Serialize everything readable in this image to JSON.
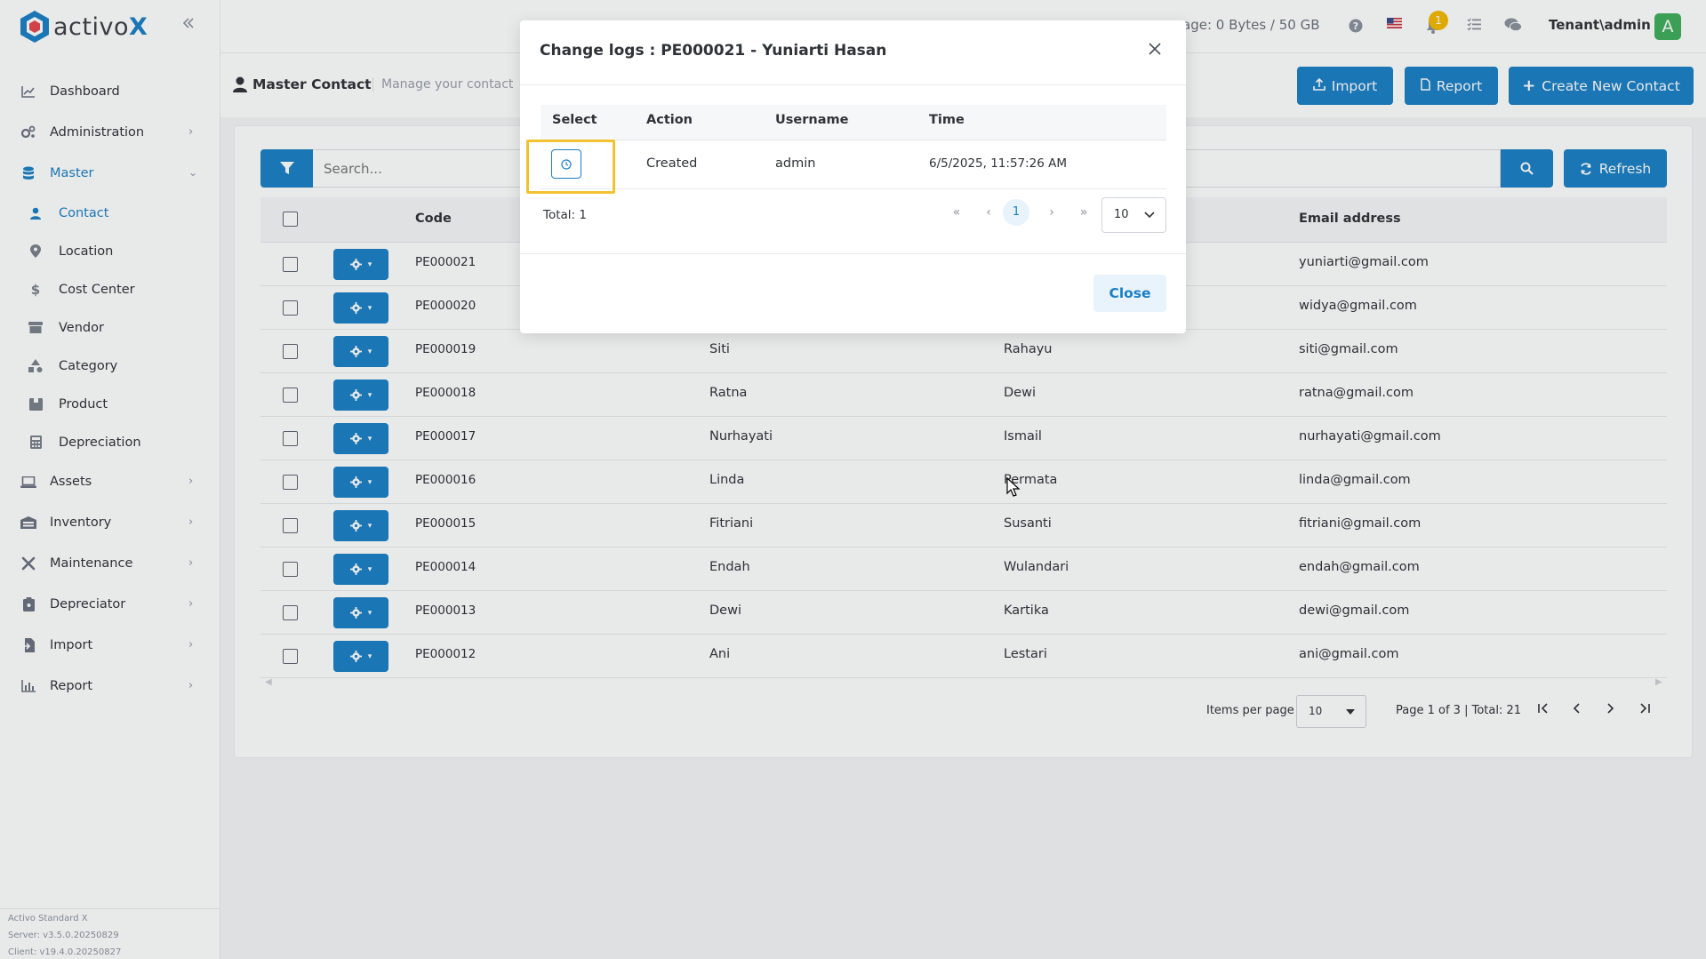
{
  "brand": {
    "name_plain": "activo",
    "name_accent": "X"
  },
  "sidebar": {
    "items": [
      {
        "label": "Dashboard",
        "icon": "chart-line-icon",
        "has_children": false
      },
      {
        "label": "Administration",
        "icon": "gears-icon",
        "has_children": true
      },
      {
        "label": "Master",
        "icon": "database-icon",
        "has_children": true,
        "expanded": true
      }
    ],
    "master_children": [
      {
        "label": "Contact",
        "icon": "user-icon",
        "active": true
      },
      {
        "label": "Location",
        "icon": "map-pin-icon"
      },
      {
        "label": "Cost Center",
        "icon": "dollar-icon"
      },
      {
        "label": "Vendor",
        "icon": "store-icon"
      },
      {
        "label": "Category",
        "icon": "shapes-icon"
      },
      {
        "label": "Product",
        "icon": "box-icon"
      },
      {
        "label": "Depreciation",
        "icon": "calculator-icon"
      }
    ],
    "items_after": [
      {
        "label": "Assets",
        "icon": "laptop-icon"
      },
      {
        "label": "Inventory",
        "icon": "warehouse-icon"
      },
      {
        "label": "Maintenance",
        "icon": "tools-icon"
      },
      {
        "label": "Depreciator",
        "icon": "clipboard-icon"
      },
      {
        "label": "Import",
        "icon": "file-import-icon"
      },
      {
        "label": "Report",
        "icon": "chart-bar-icon"
      }
    ],
    "footer": {
      "product": "Activo Standard X",
      "server": "Server: v3.5.0.20250829",
      "client": "Client: v19.4.0.20250827"
    }
  },
  "topbar": {
    "storage": "age: 0 Bytes / 50 GB",
    "notification_count": "1",
    "user": "Tenant\\admin",
    "avatar_letter": "A"
  },
  "page": {
    "title": "Master Contact",
    "subtitle": "Manage your contact",
    "buttons": {
      "import": "Import",
      "report": "Report",
      "create": "Create New Contact"
    }
  },
  "toolbar": {
    "search_placeholder": "Search...",
    "refresh": "Refresh"
  },
  "table": {
    "headers": {
      "code": "Code",
      "email": "Email address"
    },
    "rows": [
      {
        "code": "PE000021",
        "first": "",
        "last": "",
        "email": "yuniarti@gmail.com"
      },
      {
        "code": "PE000020",
        "first": "",
        "last": "",
        "email": "widya@gmail.com"
      },
      {
        "code": "PE000019",
        "first": "Siti",
        "last": "Rahayu",
        "email": "siti@gmail.com"
      },
      {
        "code": "PE000018",
        "first": "Ratna",
        "last": "Dewi",
        "email": "ratna@gmail.com"
      },
      {
        "code": "PE000017",
        "first": "Nurhayati",
        "last": "Ismail",
        "email": "nurhayati@gmail.com"
      },
      {
        "code": "PE000016",
        "first": "Linda",
        "last": "Permata",
        "email": "linda@gmail.com"
      },
      {
        "code": "PE000015",
        "first": "Fitriani",
        "last": "Susanti",
        "email": "fitriani@gmail.com"
      },
      {
        "code": "PE000014",
        "first": "Endah",
        "last": "Wulandari",
        "email": "endah@gmail.com"
      },
      {
        "code": "PE000013",
        "first": "Dewi",
        "last": "Kartika",
        "email": "dewi@gmail.com"
      },
      {
        "code": "PE000012",
        "first": "Ani",
        "last": "Lestari",
        "email": "ani@gmail.com"
      }
    ],
    "pager": {
      "items_per_page_label": "Items per page",
      "items_per_page": "10",
      "info": "Page 1 of 3 | Total: 21"
    }
  },
  "modal": {
    "title": "Change logs : PE000021 - Yuniarti Hasan",
    "headers": {
      "select": "Select",
      "action": "Action",
      "username": "Username",
      "time": "Time"
    },
    "row": {
      "action": "Created",
      "username": "admin",
      "time": "6/5/2025, 11:57:26 AM"
    },
    "total": "Total: 1",
    "current_page": "1",
    "page_size": "10",
    "close": "Close"
  },
  "colors": {
    "primary": "#1a7fc4",
    "highlight": "#f2c230",
    "badge": "#f5b800",
    "avatar": "#3fad5b"
  }
}
